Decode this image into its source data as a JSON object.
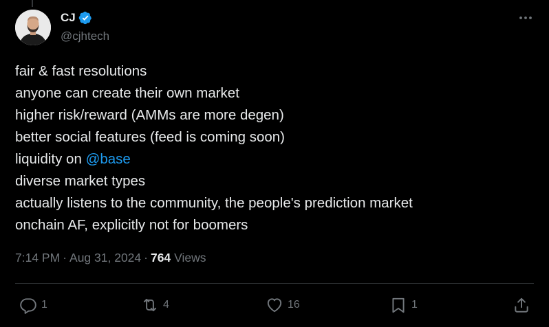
{
  "author": {
    "name": "CJ",
    "handle": "@cjhtech",
    "verified": true
  },
  "post": {
    "lines": [
      {
        "text": "fair & fast resolutions"
      },
      {
        "text": "anyone can create their own market"
      },
      {
        "text": "higher risk/reward (AMMs are more degen)"
      },
      {
        "text": "better social features (feed is coming soon)"
      },
      {
        "prefix": "liquidity on ",
        "mention": "@base"
      },
      {
        "text": "diverse market types"
      },
      {
        "text": "actually listens to the community, the people's prediction market"
      },
      {
        "text": "onchain AF, explicitly not for boomers"
      }
    ]
  },
  "meta": {
    "time": "7:14 PM",
    "date": "Aug 31, 2024",
    "separator": "·",
    "views_count": "764",
    "views_label": "Views"
  },
  "actions": {
    "reply_count": "1",
    "repost_count": "4",
    "like_count": "16",
    "bookmark_count": "1"
  },
  "icons": {
    "more": "more-horizontal-icon",
    "reply": "reply-icon",
    "repost": "repost-icon",
    "like": "heart-icon",
    "bookmark": "bookmark-icon",
    "share": "share-icon",
    "verified": "verified-badge-icon"
  },
  "colors": {
    "background": "#000000",
    "text_primary": "#e7e9ea",
    "text_secondary": "#71767b",
    "accent": "#1d9bf0",
    "divider": "#2f3336"
  }
}
